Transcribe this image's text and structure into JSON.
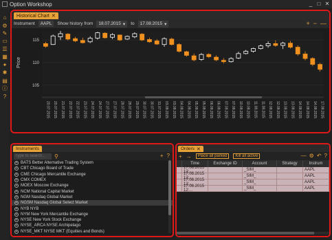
{
  "window": {
    "title": "Option Workshop",
    "minimize": "_",
    "maximize": "□",
    "close": "✕"
  },
  "side_toolbar": {
    "icons": [
      "home-icon",
      "settings-icon",
      "pencil-icon",
      "folder-icon",
      "list-icon",
      "chart-icon",
      "star-icon",
      "gear-icon",
      "document-icon",
      "info-icon",
      "help-icon"
    ]
  },
  "chart_tab": {
    "label": "Historical Chart",
    "close": "✕"
  },
  "chart_toolbar": {
    "instrument_label": "Instrument",
    "instrument_value": "AAPL",
    "show_history_label": "Show history from",
    "from_date": "18.07.2015",
    "to_label": "to",
    "to_date": "17.08.2015",
    "dropdown_glyph": "▾",
    "zoom_in": "+",
    "zoom_out": "−",
    "reset": "—"
  },
  "chart_data": {
    "type": "candlestick",
    "ylabel": "Price",
    "ylim": [
      103,
      117
    ],
    "yticks": [
      105,
      110,
      115
    ],
    "grid": true,
    "colors": {
      "up": "#ffffff",
      "down": "#f0901e"
    },
    "x": [
      "20.07.2015",
      "20.07.2015",
      "21.07.2015",
      "22.07.2015",
      "22.07.2015",
      "23.07.2015",
      "24.07.2015",
      "24.07.2015",
      "27.07.2015",
      "27.07.2015",
      "28.07.2015",
      "28.07.2015",
      "29.07.2015",
      "30.07.2015",
      "30.07.2015",
      "31.07.2015",
      "03.08.2015",
      "03.08.2015",
      "04.08.2015",
      "04.08.2015",
      "05.08.2015",
      "05.08.2015",
      "06.08.2015",
      "06.08.2015",
      "07.08.2015",
      "07.08.2015",
      "10.08.2015",
      "10.08.2015",
      "11.08.2015",
      "11.08.2015",
      "12.08.2015",
      "12.08.2015",
      "13.08.2015",
      "13.08.2015",
      "14.08.2015",
      "14.08.2015",
      "14.08.2015",
      "17.08.2015"
    ],
    "candles": [
      [
        114.2,
        114.6,
        113.3,
        113.6
      ],
      [
        114.0,
        116.2,
        113.9,
        115.9
      ],
      [
        115.7,
        117.0,
        115.0,
        116.4
      ],
      [
        116.3,
        116.5,
        114.9,
        115.2
      ],
      [
        115.3,
        115.7,
        114.5,
        114.8
      ],
      [
        114.9,
        115.5,
        114.2,
        114.4
      ],
      [
        114.6,
        115.8,
        114.3,
        115.4
      ],
      [
        115.4,
        116.8,
        115.1,
        116.6
      ],
      [
        116.5,
        116.7,
        115.3,
        115.5
      ],
      [
        115.6,
        116.5,
        115.2,
        116.2
      ],
      [
        116.1,
        116.2,
        114.8,
        115.0
      ],
      [
        115.2,
        116.0,
        115.0,
        115.8
      ],
      [
        115.7,
        116.7,
        115.4,
        116.4
      ],
      [
        116.3,
        116.5,
        114.8,
        115.0
      ],
      [
        115.1,
        115.5,
        114.4,
        114.6
      ],
      [
        114.8,
        115.2,
        113.9,
        114.1
      ],
      [
        114.0,
        115.6,
        113.5,
        115.3
      ],
      [
        115.2,
        115.5,
        113.8,
        114.0
      ],
      [
        114.0,
        114.3,
        112.2,
        112.5
      ],
      [
        112.4,
        112.6,
        111.3,
        111.6
      ],
      [
        111.5,
        112.0,
        110.3,
        110.6
      ],
      [
        110.7,
        112.1,
        110.4,
        111.8
      ],
      [
        111.8,
        112.1,
        111.0,
        111.3
      ],
      [
        111.2,
        111.6,
        110.3,
        110.6
      ],
      [
        110.5,
        111.0,
        109.8,
        110.2
      ],
      [
        110.2,
        111.2,
        110.0,
        110.9
      ],
      [
        111.0,
        112.4,
        110.8,
        112.0
      ],
      [
        112.0,
        112.8,
        111.8,
        112.5
      ],
      [
        112.5,
        113.3,
        112.2,
        113.1
      ],
      [
        113.1,
        114.0,
        112.9,
        113.7
      ],
      [
        113.7,
        114.7,
        113.3,
        114.2
      ],
      [
        114.2,
        114.9,
        113.5,
        113.8
      ],
      [
        113.8,
        114.6,
        113.0,
        114.3
      ],
      [
        114.3,
        114.8,
        113.1,
        113.4
      ],
      [
        113.4,
        113.8,
        111.5,
        111.9
      ],
      [
        111.9,
        112.5,
        110.5,
        110.9
      ],
      [
        110.9,
        111.2,
        109.2,
        109.6
      ],
      [
        109.6,
        109.9,
        108.0,
        108.5
      ]
    ]
  },
  "instruments_panel": {
    "tab_label": "Instruments",
    "search_placeholder": "Type to search...",
    "add": "+",
    "help": "?",
    "items": [
      "BATS Better Alternative Trading System",
      "CBT Chicago Board of Trade",
      "CME Chicago Mercantile Exchange",
      "CMX COMEX",
      "MOEX Moscow Exchange",
      "NCM National Capital Market",
      "NGM Nasdaq Global Market",
      "NGSM Nasdaq Global Select Market",
      "NYB NYB",
      "NYM New York Mercantile Exchange",
      "NYSE New York Stock Exchange",
      "NYSE_ARCA NYSE Archipelago",
      "NYSE_MKT NYSE MKT (Equities and Bonds)"
    ]
  },
  "orders_panel": {
    "tab_label": "Orders",
    "place_all": "Place all parked",
    "kill_all": "Kill all active",
    "columns": [
      "Time",
      "Exchange ID",
      "Account",
      "Strategy",
      "Instrum"
    ],
    "rows": [
      [
        "17.08.2015 12:...",
        "",
        "_SIM_",
        "",
        "AAPL"
      ],
      [
        "17.08.2015 12:...",
        "",
        "_SIM_",
        "",
        "AAPL"
      ],
      [
        "17.08.2015 12:...",
        "",
        "_SIM_",
        "",
        "AAPL"
      ],
      [
        "17.08.2015 12:...",
        "",
        "_SIM_",
        "",
        "AAPL"
      ]
    ]
  }
}
